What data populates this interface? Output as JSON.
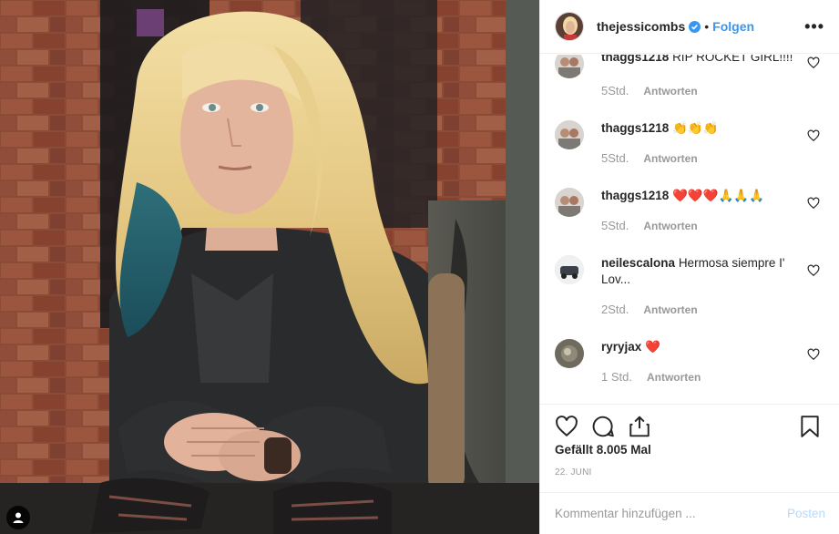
{
  "post": {
    "account": "thejessicombs",
    "separator": "•",
    "follow_label": "Folgen",
    "more_label": "•••",
    "likes_text": "Gefällt 8.005 Mal",
    "date_text": "22. JUNI"
  },
  "comments": [
    {
      "user": "thaggs1218",
      "text": "RIP ROCKET GIRL!!!!",
      "emoji": "",
      "time": "5Std.",
      "reply": "Antworten"
    },
    {
      "user": "thaggs1218",
      "text": "",
      "emoji": "👏👏👏",
      "time": "5Std.",
      "reply": "Antworten"
    },
    {
      "user": "thaggs1218",
      "text": "",
      "emoji": "❤️❤️❤️🙏🙏🙏",
      "time": "5Std.",
      "reply": "Antworten"
    },
    {
      "user": "neilescalona",
      "text": "Hermosa siempre I' Lov...",
      "emoji": "",
      "time": "2Std.",
      "reply": "Antworten"
    },
    {
      "user": "ryryjax",
      "text": "",
      "emoji": "❤️",
      "time": "1 Std.",
      "reply": "Antworten"
    }
  ],
  "composer": {
    "placeholder": "Kommentar hinzufügen ...",
    "post_label": "Posten"
  },
  "icons": {
    "verified": "verified-badge-icon",
    "heart": "heart-icon",
    "comment": "comment-icon",
    "share": "share-icon",
    "save": "bookmark-icon",
    "user_tag": "user-tag-icon"
  },
  "colors": {
    "accent": "#3897f0",
    "muted": "#999999",
    "heart_red": "#e0132b",
    "clap_yellow": "#f2b632"
  }
}
